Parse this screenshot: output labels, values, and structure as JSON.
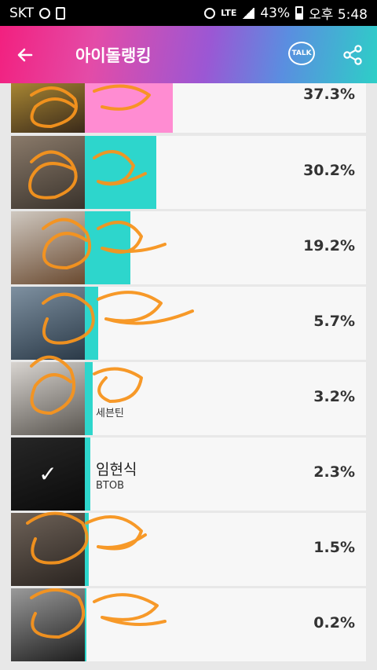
{
  "statusbar": {
    "carrier": "SKT",
    "lte": "LTE",
    "battery": "43%",
    "time": "오후 5:48"
  },
  "header": {
    "title": "아이돌랭킹",
    "talk_label": "TALK",
    "back_icon": "arrow-left-icon",
    "share_icon": "share-icon"
  },
  "colors": {
    "bar_pink": "#ff8cd2",
    "bar_teal": "#2dd6cc"
  },
  "ranking": [
    {
      "name": "",
      "group": "",
      "percent": "37.3%",
      "value": 37.3,
      "bar_color": "#ff8cd2",
      "selected": false
    },
    {
      "name": "",
      "group": "",
      "percent": "30.2%",
      "value": 30.2,
      "bar_color": "#2dd6cc",
      "selected": false
    },
    {
      "name": "",
      "group": "",
      "percent": "19.2%",
      "value": 19.2,
      "bar_color": "#2dd6cc",
      "selected": false
    },
    {
      "name": "",
      "group": "",
      "percent": "5.7%",
      "value": 5.7,
      "bar_color": "#2dd6cc",
      "selected": false
    },
    {
      "name": "",
      "group": "세븐틴",
      "percent": "3.2%",
      "value": 3.2,
      "bar_color": "#2dd6cc",
      "selected": false
    },
    {
      "name": "임현식",
      "group": "BTOB",
      "percent": "2.3%",
      "value": 2.3,
      "bar_color": "#2dd6cc",
      "selected": true
    },
    {
      "name": "",
      "group": "",
      "percent": "1.5%",
      "value": 1.5,
      "bar_color": "#2dd6cc",
      "selected": false
    },
    {
      "name": "",
      "group": "",
      "percent": "0.2%",
      "value": 0.2,
      "bar_color": "#2dd6cc",
      "selected": false
    }
  ]
}
